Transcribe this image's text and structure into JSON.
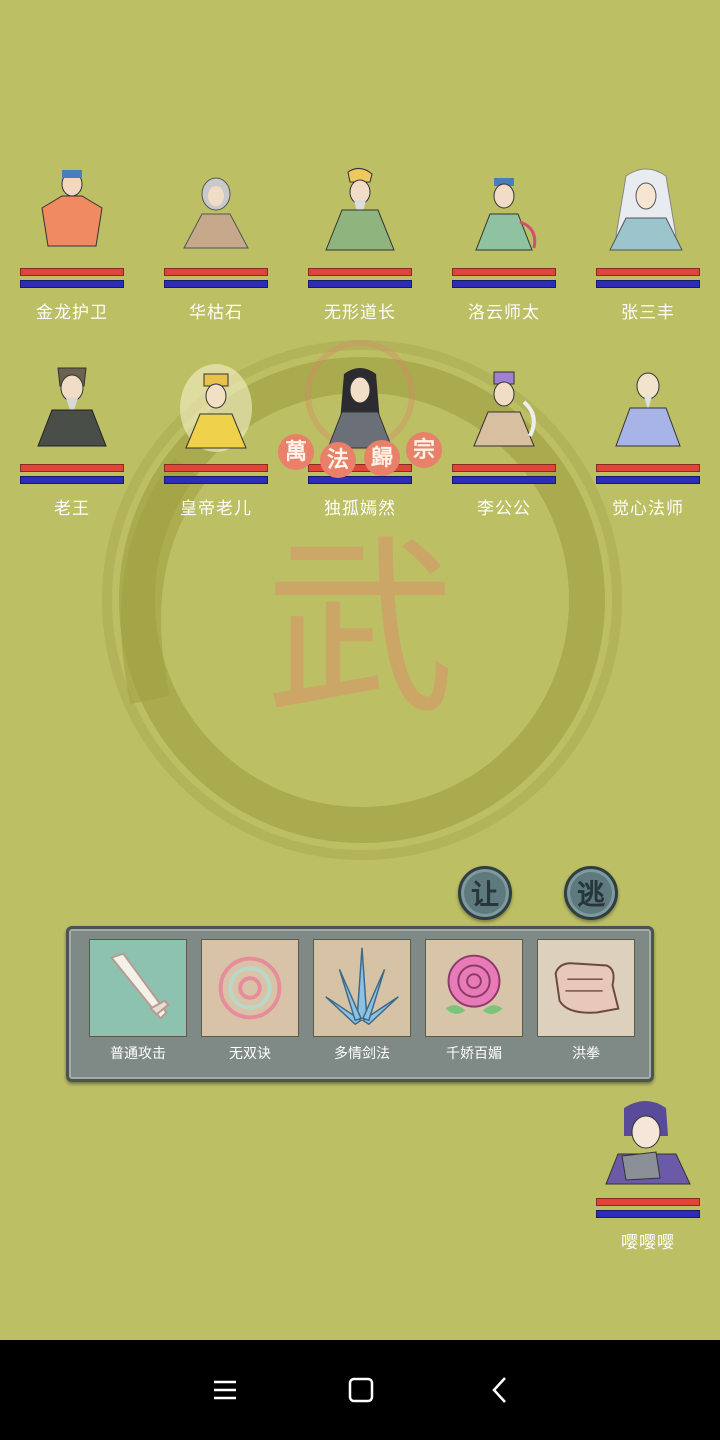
{
  "enemies_row1": [
    {
      "name": "金龙护卫"
    },
    {
      "name": "华枯石"
    },
    {
      "name": "无形道长"
    },
    {
      "name": "洛云师太"
    },
    {
      "name": "张三丰"
    }
  ],
  "enemies_row2": [
    {
      "name": "老王"
    },
    {
      "name": "皇帝老儿"
    },
    {
      "name": "独孤嫣然"
    },
    {
      "name": "李公公"
    },
    {
      "name": "觉心法师"
    }
  ],
  "status_banner": [
    "萬",
    "法",
    "歸",
    "宗"
  ],
  "background_glyph": "武",
  "actions": {
    "yield_label": "让",
    "flee_label": "逃"
  },
  "skills": [
    {
      "label": "普通攻击",
      "icon": "sword-icon"
    },
    {
      "label": "无双诀",
      "icon": "spiral-icon"
    },
    {
      "label": "多情剑法",
      "icon": "blades-icon"
    },
    {
      "label": "千娇百媚",
      "icon": "rose-icon"
    },
    {
      "label": "洪拳",
      "icon": "fist-icon"
    }
  ],
  "player": {
    "name": "嘤嘤嘤"
  },
  "colors": {
    "background": "#bcbf63",
    "hp_bar": "#e0453a",
    "mp_bar": "#2d2db8",
    "banner": "#e8806a"
  },
  "navbar": {
    "icons": [
      "menu-icon",
      "home-icon",
      "back-icon"
    ]
  }
}
